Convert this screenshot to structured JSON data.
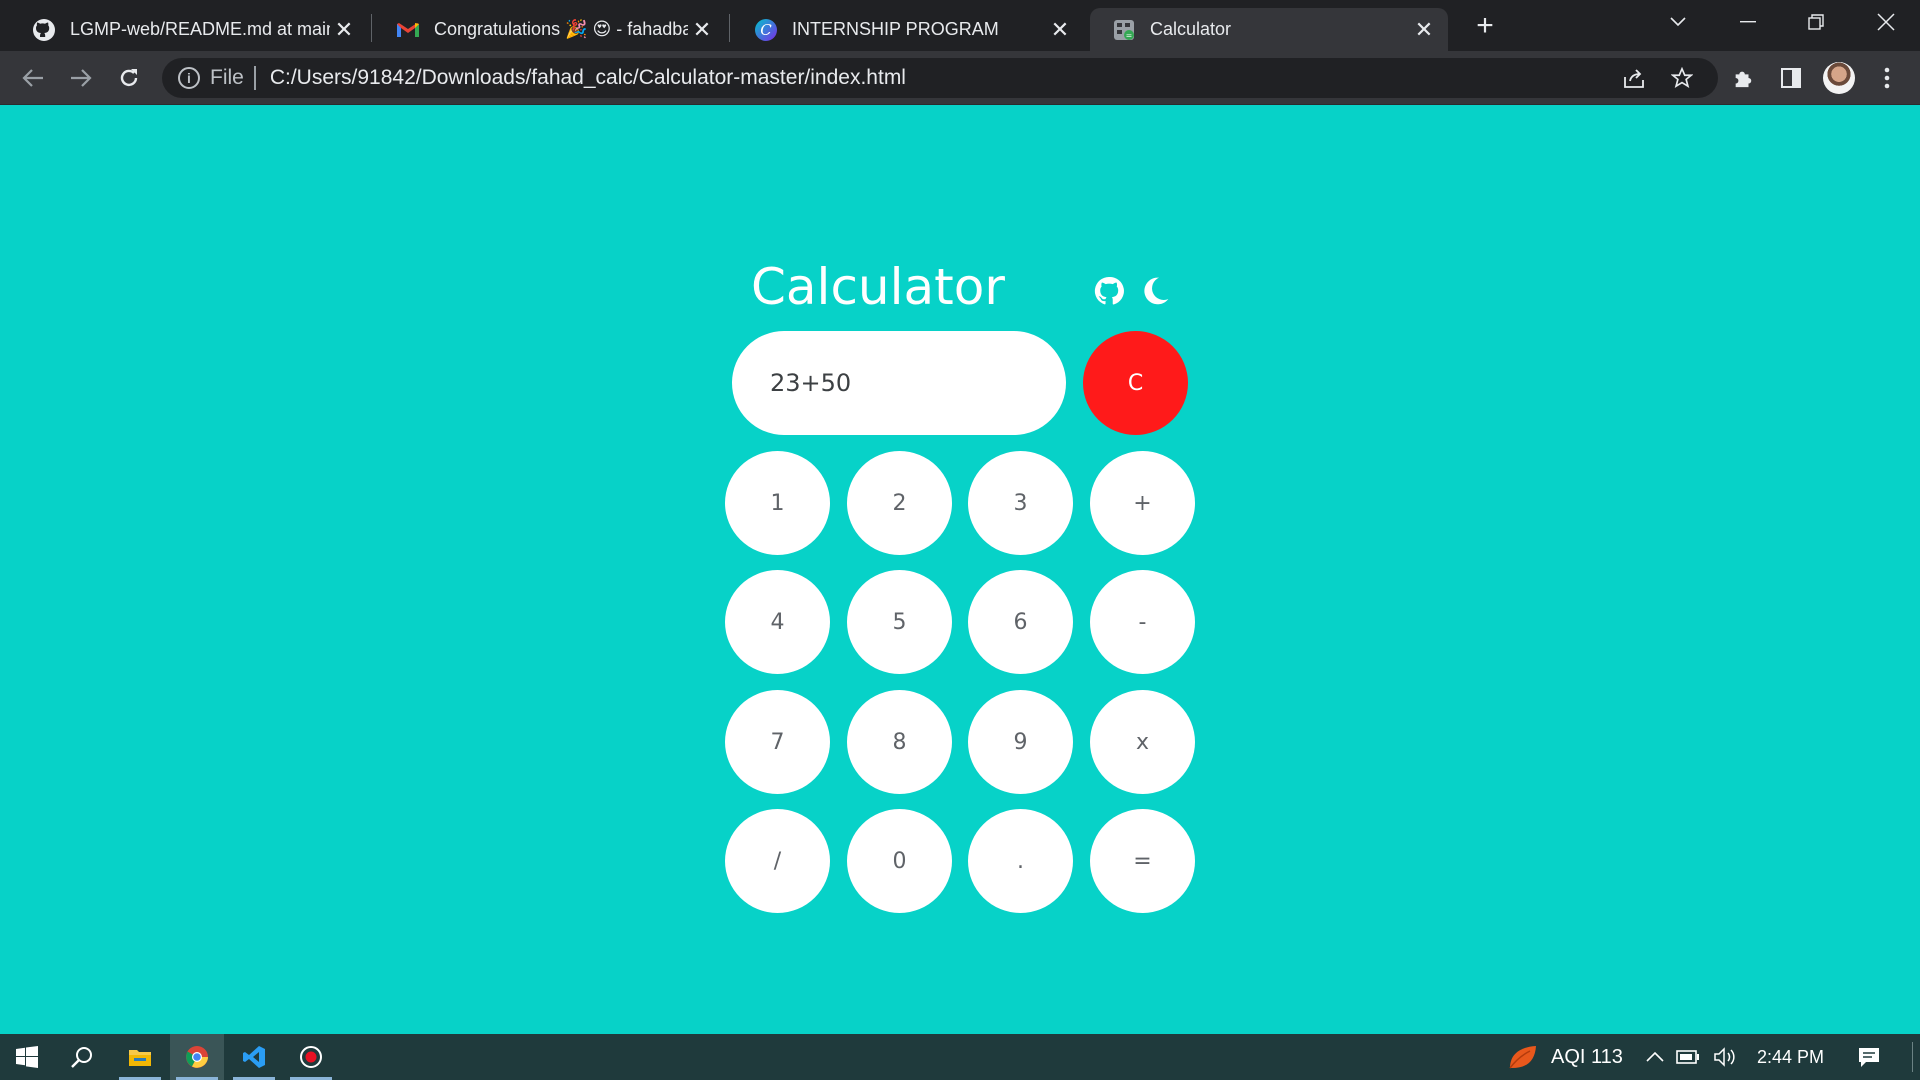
{
  "browser": {
    "tabs": [
      {
        "title": "LGMP-web/README.md at main",
        "icon": "github-icon"
      },
      {
        "title": "Congratulations 🎉 😍 - fahadba",
        "icon": "gmail-icon"
      },
      {
        "title": "INTERNSHIP PROGRAM",
        "icon": "canva-icon"
      },
      {
        "title": "Calculator",
        "icon": "calculator-favicon"
      }
    ],
    "address": {
      "scheme_label": "File",
      "url": "C:/Users/91842/Downloads/fahad_calc/Calculator-master/index.html"
    }
  },
  "app": {
    "title": "Calculator",
    "display_value": "23+50",
    "clear_label": "C",
    "keys": [
      [
        "1",
        "2",
        "3",
        "+"
      ],
      [
        "4",
        "5",
        "6",
        "-"
      ],
      [
        "7",
        "8",
        "9",
        "x"
      ],
      [
        "/",
        "0",
        ".",
        "="
      ]
    ],
    "colors": {
      "background": "#07d2c8",
      "clear": "#ff1a1a",
      "key": "#ffffff"
    }
  },
  "taskbar": {
    "aqi": "AQI 113",
    "time": "2:44 PM"
  }
}
